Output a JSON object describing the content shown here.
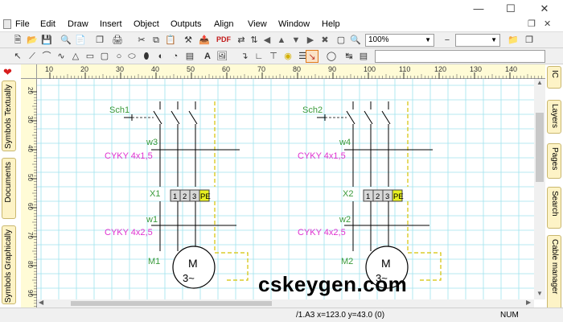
{
  "menubar": {
    "items": [
      "File",
      "Edit",
      "Draw",
      "Insert",
      "Object",
      "Outputs",
      "Align",
      "View",
      "Window",
      "Help"
    ]
  },
  "toolbar": {
    "zoom_value": "100%"
  },
  "left_tabs": [
    "Symbols Textually",
    "Documents",
    "Symbols Graphically"
  ],
  "right_tabs": [
    "IC",
    "Layers",
    "Pages",
    "Search",
    "Cable manager"
  ],
  "ruler": {
    "h_ticks": [
      "10",
      "20",
      "30",
      "40",
      "50",
      "60",
      "70",
      "80",
      "90",
      "100",
      "110",
      "120",
      "130",
      "140"
    ],
    "v_ticks": [
      "20",
      "30",
      "40",
      "50",
      "60",
      "70",
      "80",
      "90"
    ]
  },
  "schematic": {
    "units": [
      {
        "switch_label": "Sch1",
        "cable1_name": "w3",
        "cable1_type": "CYKY 4x1,5",
        "terminal_label": "X1",
        "terminals": [
          "1",
          "2",
          "3",
          "PE"
        ],
        "cable2_name": "w1",
        "cable2_type": "CYKY 4x2,5",
        "motor_label": "M1",
        "motor_symbol": "M",
        "motor_phase": "3~"
      },
      {
        "switch_label": "Sch2",
        "cable1_name": "w4",
        "cable1_type": "CYKY 4x1,5",
        "terminal_label": "X2",
        "terminals": [
          "1",
          "2",
          "3",
          "PE"
        ],
        "cable2_name": "w2",
        "cable2_type": "CYKY 4x2,5",
        "motor_label": "M2",
        "motor_symbol": "M",
        "motor_phase": "3~"
      }
    ]
  },
  "watermark": "cskeygen.com",
  "status": {
    "coords": "/1.A3  x=123.0  y=43.0 (0)",
    "mode": "NUM"
  },
  "colors": {
    "grid": "#9fe3ee",
    "label_green": "#3a9a3a",
    "label_pink": "#e030d0",
    "pe_fill": "#e8f020",
    "terminal_fill": "#d8d8d8",
    "pe_wire": "#d4c200",
    "tab_fill": "#fdf3c6"
  }
}
